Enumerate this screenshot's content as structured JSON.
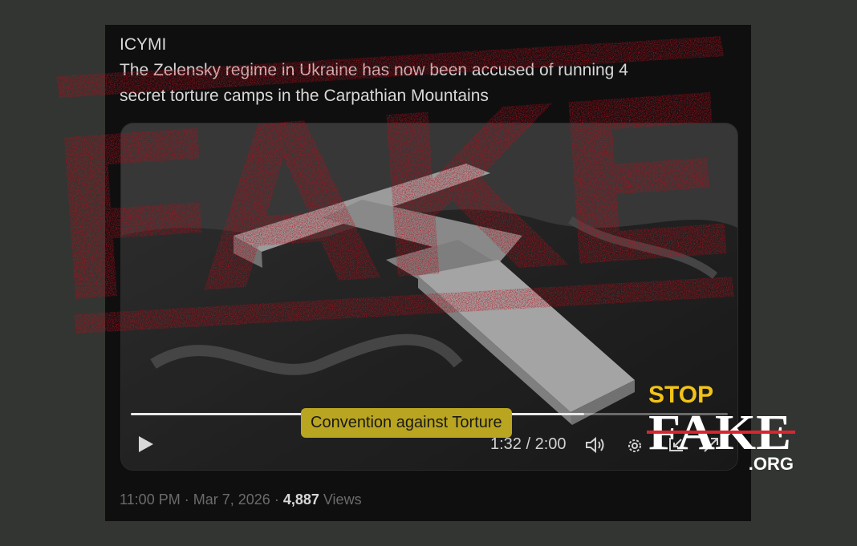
{
  "tweet": {
    "label": "ICYMI",
    "text_line1": "The Zelensky regime in Ukraine has now been accused of running 4",
    "text_line2": "secret torture camps in the Carpathian Mountains",
    "caption": "Convention against Torture",
    "progress": 0.76
  },
  "player": {
    "time": "1:32 / 2:00",
    "play_icon": "play-icon",
    "volume_icon": "volume-icon",
    "settings_icon": "gear-icon",
    "exit_fullscreen_icon": "minimize-icon",
    "expand_icon": "expand-icon"
  },
  "meta": {
    "time": "11:00 PM",
    "date": "Mar 7, 2026",
    "views_count": "4,887",
    "views_label": "Views"
  },
  "stamp": {
    "word": "FAKE",
    "color": "#b3121d"
  },
  "logo": {
    "line1": "STOP",
    "line2": "FAKE",
    "line3": ".ORG",
    "accent_yellow": "#f2c318",
    "accent_red": "#d8262e"
  }
}
